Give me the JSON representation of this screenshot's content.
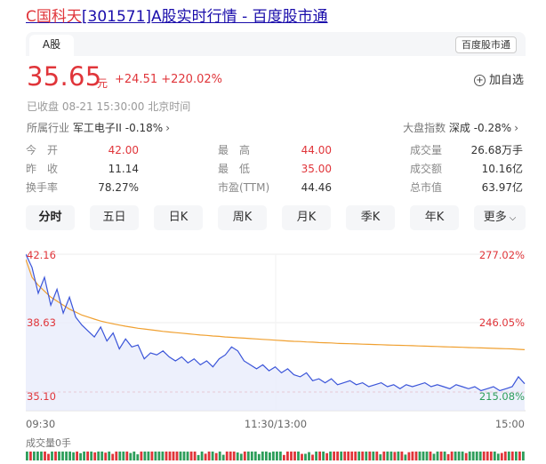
{
  "title": {
    "prefix": "C国科天",
    "rest": "[301571]A股实时行情 - 百度股市通"
  },
  "tab": {
    "label": "A股"
  },
  "source_badge": "百度股市通",
  "quote": {
    "price": "35.65",
    "unit": "元",
    "change": "+24.51",
    "change_pct": "+220.02%",
    "add_watch": "加自选",
    "status": "已收盘  08-21 15:30:00  北京时间",
    "industry_label": "所属行业",
    "industry_value": "军工电子II -0.18%",
    "index_label": "大盘指数",
    "index_value": "深成 -0.28%"
  },
  "stats": [
    [
      {
        "k": "今　开",
        "v": "42.00",
        "red": true
      },
      {
        "k": "最　高",
        "v": "44.00",
        "red": true
      },
      {
        "k": "成交量",
        "v": "26.68万手"
      }
    ],
    [
      {
        "k": "昨　收",
        "v": "11.14"
      },
      {
        "k": "最　低",
        "v": "35.00",
        "red": true
      },
      {
        "k": "成交额",
        "v": "10.16亿"
      }
    ],
    [
      {
        "k": "换手率",
        "v": "78.27%"
      },
      {
        "k": "市盈(TTM)",
        "v": "44.46"
      },
      {
        "k": "总市值",
        "v": "63.97亿"
      }
    ]
  ],
  "periods": [
    "分时",
    "五日",
    "日K",
    "周K",
    "月K",
    "季K",
    "年K",
    "更多"
  ],
  "chart_data": {
    "type": "line",
    "title": "",
    "y_left_labels": [
      "42.16",
      "38.63",
      "35.10"
    ],
    "y_right_labels": [
      "277.02%",
      "246.05%",
      "215.08%"
    ],
    "x_labels": [
      "09:30",
      "11:30/13:00",
      "15:00"
    ],
    "volume_label": "成交量0手",
    "ylim": [
      35.1,
      42.16
    ],
    "series": [
      {
        "name": "price",
        "color": "#3b55d9",
        "values": [
          42.16,
          41.5,
          40.2,
          41.0,
          39.6,
          40.4,
          39.2,
          40.0,
          39.0,
          38.6,
          38.3,
          38.0,
          38.5,
          37.8,
          38.2,
          37.4,
          37.9,
          37.5,
          37.6,
          36.9,
          37.2,
          37.1,
          37.3,
          37.0,
          36.8,
          37.0,
          36.7,
          36.9,
          36.6,
          36.8,
          36.5,
          36.9,
          37.1,
          37.5,
          37.3,
          36.8,
          36.6,
          36.4,
          36.6,
          36.3,
          36.5,
          36.2,
          36.4,
          36.1,
          36.0,
          36.2,
          35.8,
          35.9,
          35.7,
          35.9,
          35.6,
          35.7,
          35.8,
          35.6,
          35.7,
          35.5,
          35.6,
          35.7,
          35.5,
          35.6,
          35.4,
          35.6,
          35.5,
          35.6,
          35.7,
          35.5,
          35.6,
          35.5,
          35.4,
          35.6,
          35.5,
          35.4,
          35.5,
          35.3,
          35.4,
          35.5,
          35.3,
          35.4,
          35.5,
          36.0,
          35.65
        ]
      },
      {
        "name": "avg",
        "color": "#f0a030",
        "values": [
          41.9,
          41.0,
          40.6,
          40.3,
          40.0,
          39.8,
          39.6,
          39.4,
          39.25,
          39.1,
          39.0,
          38.9,
          38.8,
          38.73,
          38.66,
          38.6,
          38.54,
          38.49,
          38.44,
          38.4,
          38.36,
          38.32,
          38.28,
          38.25,
          38.22,
          38.19,
          38.16,
          38.13,
          38.1,
          38.08,
          38.05,
          38.03,
          38.0,
          37.98,
          37.96,
          37.94,
          37.92,
          37.9,
          37.88,
          37.86,
          37.84,
          37.82,
          37.8,
          37.78,
          37.77,
          37.75,
          37.74,
          37.72,
          37.71,
          37.7,
          37.68,
          37.67,
          37.66,
          37.65,
          37.64,
          37.63,
          37.62,
          37.61,
          37.6,
          37.59,
          37.58,
          37.57,
          37.56,
          37.55,
          37.54,
          37.53,
          37.52,
          37.51,
          37.5,
          37.49,
          37.48,
          37.47,
          37.46,
          37.45,
          37.44,
          37.43,
          37.42,
          37.41,
          37.4,
          37.38,
          37.36
        ]
      }
    ],
    "colors": {
      "up": "#e0353a",
      "down": "#2e9e5b",
      "ref_line": "#e0353a",
      "fill": "#e8ecfb"
    }
  }
}
